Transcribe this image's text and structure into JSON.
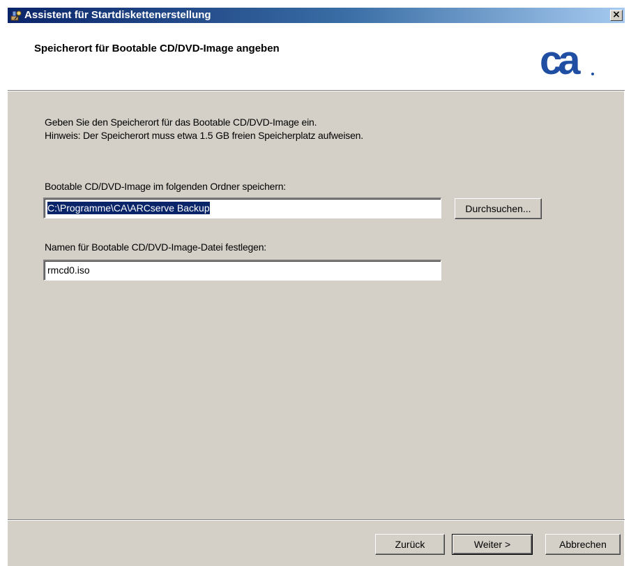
{
  "window": {
    "title": "Assistent für Startdiskettenerstellung",
    "close_glyph": "×"
  },
  "header": {
    "title": "Speicherort für Bootable CD/DVD-Image angeben",
    "logo_text": "ca",
    "logo_color": "#1f4ea3"
  },
  "content": {
    "instruction_line1": "Geben Sie den Speicherort für das Bootable CD/DVD-Image ein.",
    "instruction_line2": "Hinweis: Der Speicherort muss etwa 1.5 GB freien Speicherplatz aufweisen.",
    "folder_label": "Bootable CD/DVD-Image im folgenden Ordner speichern:",
    "folder_value": "C:\\Programme\\CA\\ARCserve Backup",
    "browse_button": "Durchsuchen...",
    "filename_label": "Namen für Bootable CD/DVD-Image-Datei festlegen:",
    "filename_value": "rmcd0.iso"
  },
  "footer": {
    "back_button": "Zurück",
    "next_button": "Weiter >",
    "cancel_button": "Abbrechen"
  }
}
